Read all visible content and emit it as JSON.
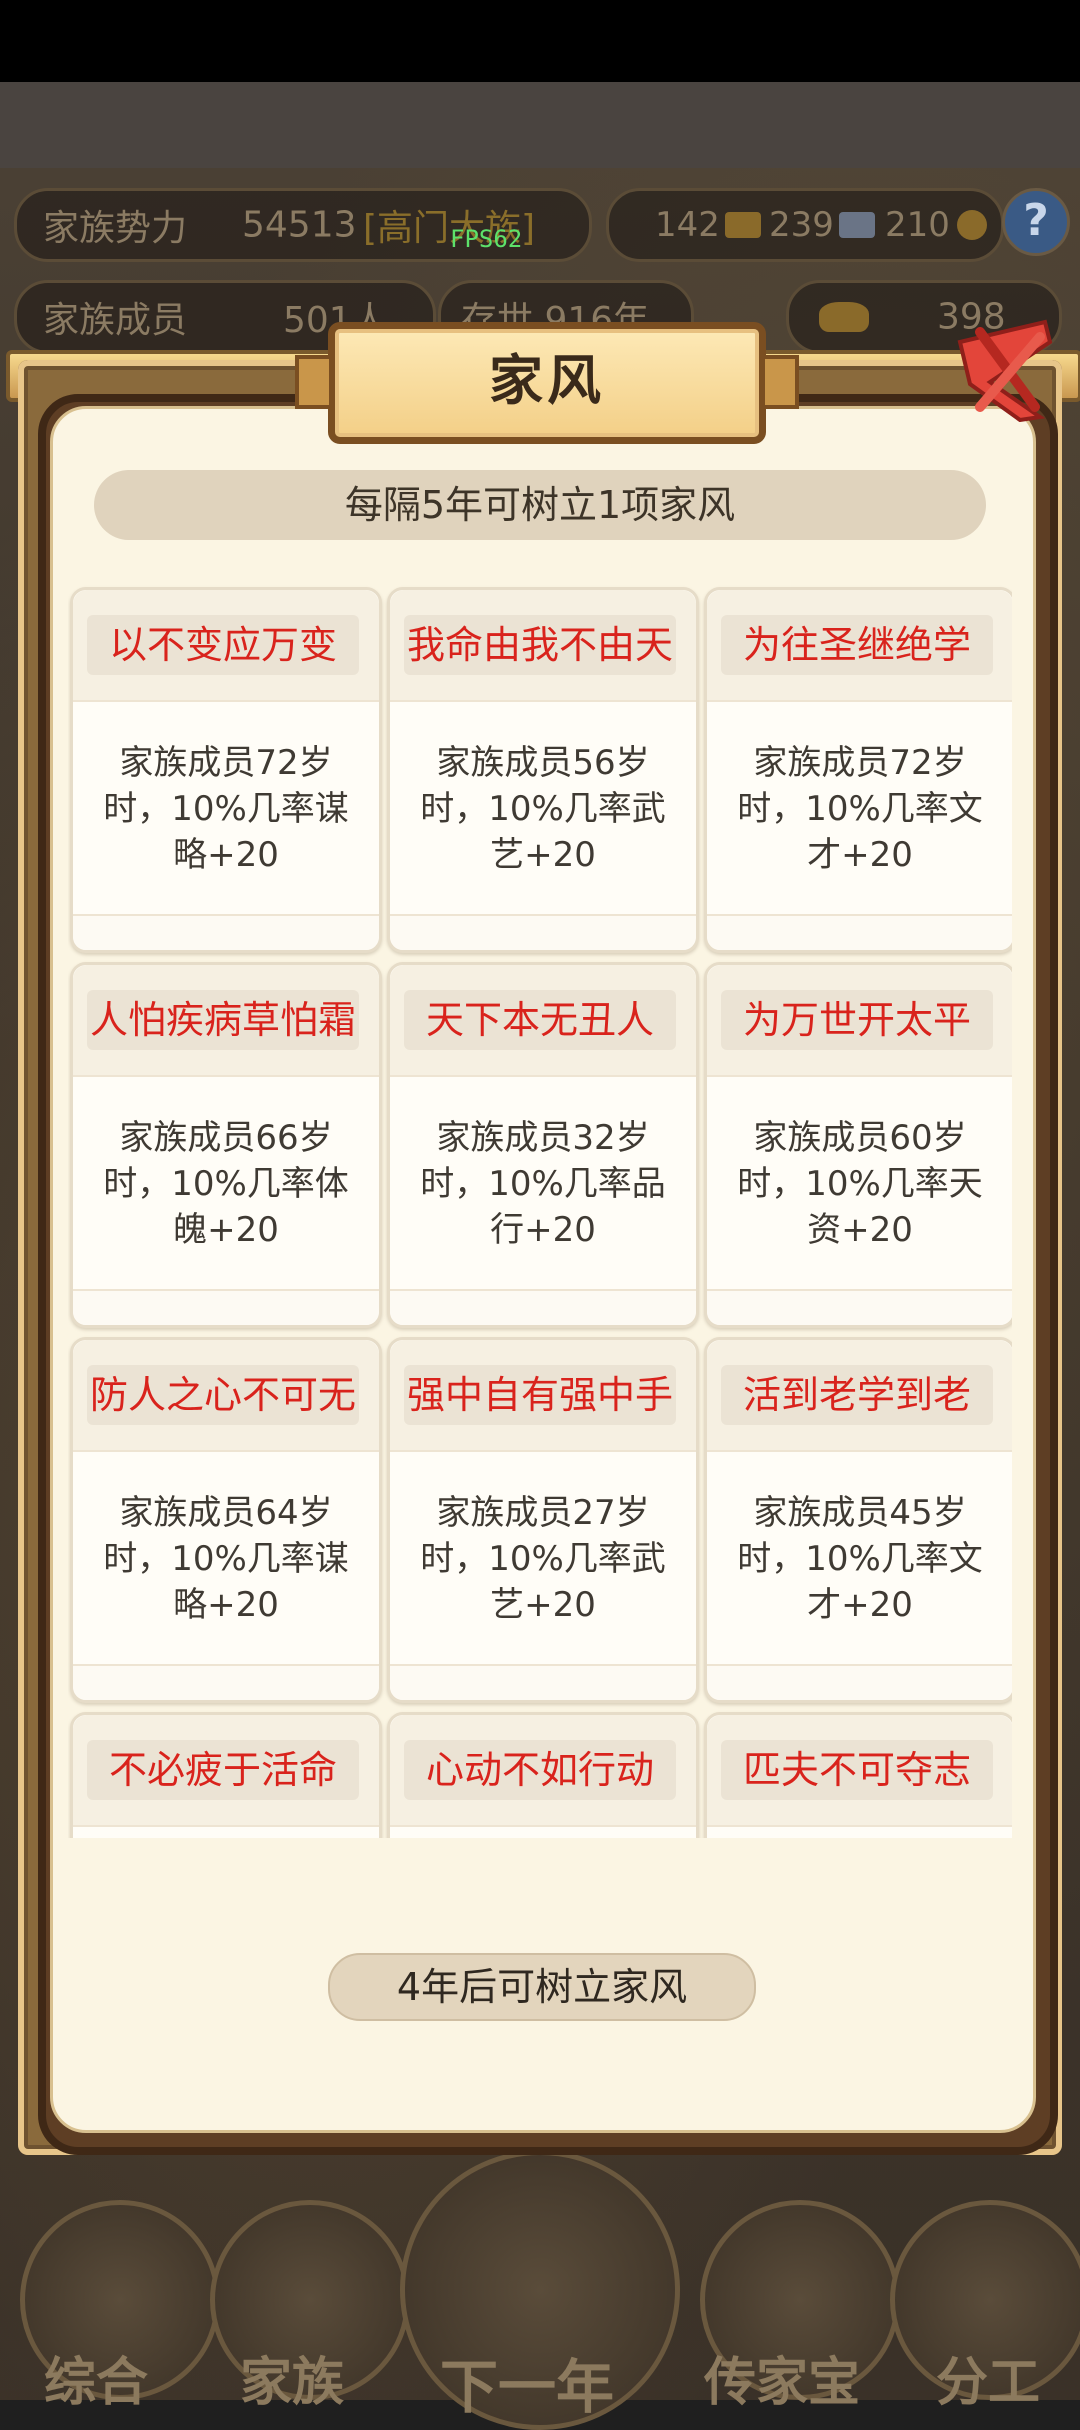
{
  "hud": {
    "power_label": "家族势力",
    "power_value": "54513",
    "power_rank": "[高门大族]",
    "members_label": "家族成员",
    "members_value": "501人",
    "alive_text": "存世 916年",
    "fps": "FPS62",
    "res1": "142",
    "res2": "239",
    "res3": "210",
    "gold": "398",
    "help": "?"
  },
  "modal": {
    "title": "家风",
    "subtitle": "每隔5年可树立1项家风",
    "action_label": "4年后可树立家风"
  },
  "cards": [
    {
      "name": "以不变应万变",
      "desc": "家族成员72岁时，10%几率谋略+20"
    },
    {
      "name": "我命由我不由天",
      "desc": "家族成员56岁时，10%几率武艺+20"
    },
    {
      "name": "为往圣继绝学",
      "desc": "家族成员72岁时，10%几率文才+20"
    },
    {
      "name": "人怕疾病草怕霜",
      "desc": "家族成员66岁时，10%几率体魄+20"
    },
    {
      "name": "天下本无丑人",
      "desc": "家族成员32岁时，10%几率品行+20"
    },
    {
      "name": "为万世开太平",
      "desc": "家族成员60岁时，10%几率天资+20"
    },
    {
      "name": "防人之心不可无",
      "desc": "家族成员64岁时，10%几率谋略+20"
    },
    {
      "name": "强中自有强中手",
      "desc": "家族成员27岁时，10%几率武艺+20"
    },
    {
      "name": "活到老学到老",
      "desc": "家族成员45岁时，10%几率文才+20"
    },
    {
      "name": "不必疲于活命",
      "desc": ""
    },
    {
      "name": "心动不如行动",
      "desc": ""
    },
    {
      "name": "匹夫不可夺志",
      "desc": ""
    }
  ],
  "bottom_nav": [
    "综合",
    "家族",
    "下一年",
    "传家宝",
    "分工"
  ]
}
